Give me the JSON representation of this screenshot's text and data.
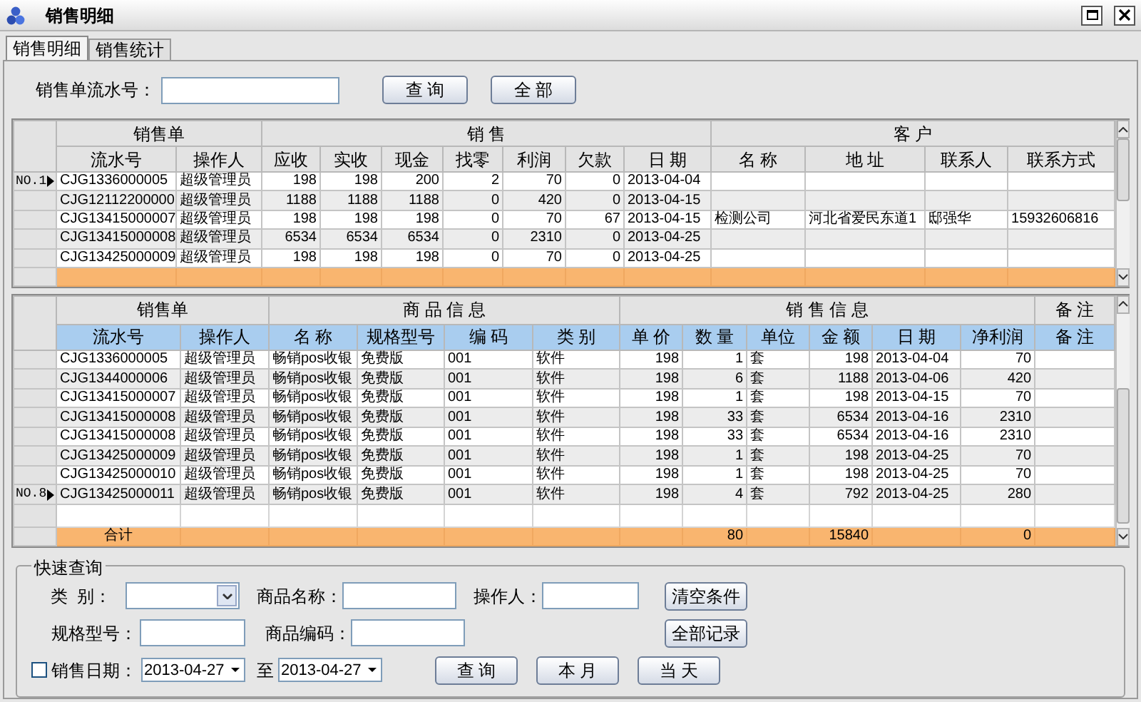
{
  "window": {
    "title": "销售明细"
  },
  "tabs": [
    {
      "label": "销售明细",
      "selected": true
    },
    {
      "label": "销售统计",
      "selected": false
    }
  ],
  "search": {
    "label": "销售单流水号：",
    "buttons": [
      "查 询",
      "全 部"
    ]
  },
  "orders_grid": {
    "groups": [
      {
        "label": "销售单",
        "columns": [
          {
            "label": "流水号",
            "kind": "text"
          },
          {
            "label": "操作人",
            "kind": "text"
          }
        ]
      },
      {
        "label": "销 售",
        "columns": [
          {
            "label": "应收",
            "kind": "number"
          },
          {
            "label": "实收",
            "kind": "number"
          },
          {
            "label": "现金",
            "kind": "number"
          },
          {
            "label": "找零",
            "kind": "number"
          },
          {
            "label": "利润",
            "kind": "number"
          },
          {
            "label": "欠款",
            "kind": "number"
          },
          {
            "label": "日 期",
            "kind": "text"
          }
        ]
      },
      {
        "label": "客 户",
        "columns": [
          {
            "label": "名 称",
            "kind": "text"
          },
          {
            "label": "地 址",
            "kind": "text"
          },
          {
            "label": "联系人",
            "kind": "text"
          },
          {
            "label": "联系方式",
            "kind": "text"
          }
        ]
      }
    ],
    "rows": [
      {
        "current": true,
        "row_label": "NO.1",
        "cells": [
          "CJG1336000005",
          "超级管理员",
          "198",
          "198",
          "200",
          "2",
          "70",
          "0",
          "2013-04-04",
          null,
          null,
          null,
          null
        ]
      },
      {
        "current": false,
        "cells": [
          "CJG12112200000",
          "超级管理员",
          "1188",
          "1188",
          "1188",
          "0",
          "420",
          "0",
          "2013-04-15",
          null,
          null,
          null,
          null
        ]
      },
      {
        "current": false,
        "cells": [
          "CJG13415000007",
          "超级管理员",
          "198",
          "198",
          "198",
          "0",
          "70",
          "67",
          "2013-04-15",
          "检测公司",
          "河北省爱民东道1",
          "邸强华",
          "15932606816"
        ]
      },
      {
        "current": false,
        "cells": [
          "CJG13415000008",
          "超级管理员",
          "6534",
          "6534",
          "6534",
          "0",
          "2310",
          "0",
          "2013-04-25",
          null,
          null,
          null,
          null
        ]
      },
      {
        "current": false,
        "cells": [
          "CJG13425000009",
          "超级管理员",
          "198",
          "198",
          "198",
          "0",
          "70",
          "0",
          "2013-04-25",
          null,
          null,
          null,
          null
        ]
      }
    ]
  },
  "items_grid": {
    "groups": [
      {
        "label": "销售单",
        "columns": [
          {
            "label": "流水号",
            "kind": "text"
          },
          {
            "label": "操作人",
            "kind": "text"
          }
        ]
      },
      {
        "label": "商 品 信 息",
        "columns": [
          {
            "label": "名 称",
            "kind": "text"
          },
          {
            "label": "规格型号",
            "kind": "text"
          },
          {
            "label": "编 码",
            "kind": "text"
          },
          {
            "label": "类 别",
            "kind": "text"
          }
        ]
      },
      {
        "label": "销 售 信 息",
        "columns": [
          {
            "label": "单 价",
            "kind": "number"
          },
          {
            "label": "数 量",
            "kind": "number"
          },
          {
            "label": "单位",
            "kind": "text"
          },
          {
            "label": "金 额",
            "kind": "number"
          },
          {
            "label": "日 期",
            "kind": "text"
          },
          {
            "label": "净利润",
            "kind": "number"
          }
        ]
      },
      {
        "label": "备 注",
        "columns": [
          {
            "label": "备 注",
            "kind": "text"
          }
        ]
      }
    ],
    "rows": [
      {
        "current": false,
        "cells": [
          "CJG1336000005",
          "超级管理员",
          "畅销pos收银",
          "免费版",
          "001",
          "软件",
          "198",
          "1",
          "套",
          "198",
          "2013-04-04",
          "70",
          null
        ]
      },
      {
        "current": false,
        "cells": [
          "CJG1344000006",
          "超级管理员",
          "畅销pos收银",
          "免费版",
          "001",
          "软件",
          "198",
          "6",
          "套",
          "1188",
          "2013-04-06",
          "420",
          null
        ]
      },
      {
        "current": false,
        "cells": [
          "CJG13415000007",
          "超级管理员",
          "畅销pos收银",
          "免费版",
          "001",
          "软件",
          "198",
          "1",
          "套",
          "198",
          "2013-04-15",
          "70",
          null
        ]
      },
      {
        "current": false,
        "cells": [
          "CJG13415000008",
          "超级管理员",
          "畅销pos收银",
          "免费版",
          "001",
          "软件",
          "198",
          "33",
          "套",
          "6534",
          "2013-04-16",
          "2310",
          null
        ]
      },
      {
        "current": false,
        "cells": [
          "CJG13415000008",
          "超级管理员",
          "畅销pos收银",
          "免费版",
          "001",
          "软件",
          "198",
          "33",
          "套",
          "6534",
          "2013-04-16",
          "2310",
          null
        ]
      },
      {
        "current": false,
        "cells": [
          "CJG13425000009",
          "超级管理员",
          "畅销pos收银",
          "免费版",
          "001",
          "软件",
          "198",
          "1",
          "套",
          "198",
          "2013-04-25",
          "70",
          null
        ]
      },
      {
        "current": false,
        "cells": [
          "CJG13425000010",
          "超级管理员",
          "畅销pos收银",
          "免费版",
          "001",
          "软件",
          "198",
          "1",
          "套",
          "198",
          "2013-04-25",
          "70",
          null
        ]
      },
      {
        "current": true,
        "row_label": "NO.8",
        "cells": [
          "CJG13425000011",
          "超级管理员",
          "畅销pos收银",
          "免费版",
          "001",
          "软件",
          "198",
          "4",
          "套",
          "792",
          "2013-04-25",
          "280",
          null
        ]
      }
    ],
    "total_row": {
      "cells": [
        "合计",
        null,
        null,
        null,
        null,
        null,
        null,
        "80",
        null,
        "15840",
        null,
        "0",
        null
      ]
    }
  },
  "quick_search": {
    "title": "快速查询",
    "category_label": "类  别：",
    "product_name_label": "商品名称：",
    "operator_label": "操作人：",
    "clear_button": "清空条件",
    "spec_label": "规格型号：",
    "product_code_label": "商品编码：",
    "all_records_button": "全部记录",
    "date_filter": {
      "checked": false,
      "label": "销售日期：",
      "from": "2013-04-27",
      "separator": "至",
      "to": "2013-04-27"
    },
    "buttons": [
      "查 询",
      "本 月",
      "当 天"
    ]
  }
}
